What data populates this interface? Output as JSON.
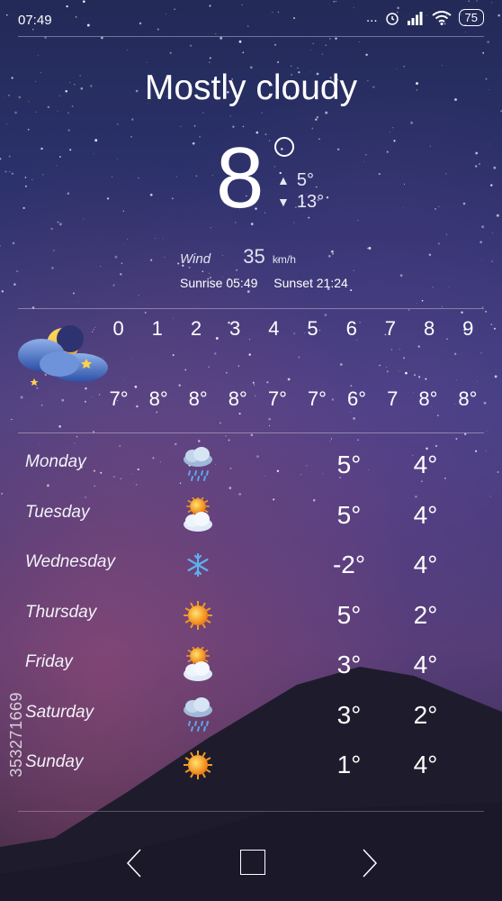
{
  "status_bar": {
    "time": "07:49",
    "dots": "...",
    "battery": "75"
  },
  "current": {
    "condition": "Mostly cloudy",
    "temperature": "8",
    "min": "5°",
    "max": "13°",
    "wind_label": "Wind",
    "wind_value": "35",
    "wind_unit": "km/h",
    "sunrise": "Sunrise 05:49",
    "sunset": "Sunset 21:24",
    "icon": "moon-cloud-icon"
  },
  "hourly": {
    "hours": [
      "0",
      "1",
      "2",
      "3",
      "4",
      "5",
      "6",
      "7",
      "8",
      "9"
    ],
    "temps": [
      "7°",
      "8°",
      "8°",
      "8°",
      "7°",
      "7°",
      "6°",
      "7",
      "8°",
      "8°"
    ]
  },
  "daily": [
    {
      "day": "Monday",
      "icon": "rain-cloud-icon",
      "temp1": "5°",
      "temp2": "4°"
    },
    {
      "day": "Tuesday",
      "icon": "sun-cloud-icon",
      "temp1": "5°",
      "temp2": "4°"
    },
    {
      "day": "Wednesday",
      "icon": "snowflake-icon",
      "temp1": "-2°",
      "temp2": "4°"
    },
    {
      "day": "Thursday",
      "icon": "sun-icon",
      "temp1": "5°",
      "temp2": "2°"
    },
    {
      "day": "Friday",
      "icon": "sun-cloud-icon",
      "temp1": "3°",
      "temp2": "4°"
    },
    {
      "day": "Saturday",
      "icon": "rain-cloud-icon",
      "temp1": "3°",
      "temp2": "2°"
    },
    {
      "day": "Sunday",
      "icon": "sun-icon",
      "temp1": "1°",
      "temp2": "4°"
    }
  ],
  "watermark": "353271669",
  "colors": {
    "sky_top": "#232a57",
    "sky_mid": "#3a3f86",
    "dusk": "#a85078",
    "mountain": "#1d1b2b"
  }
}
